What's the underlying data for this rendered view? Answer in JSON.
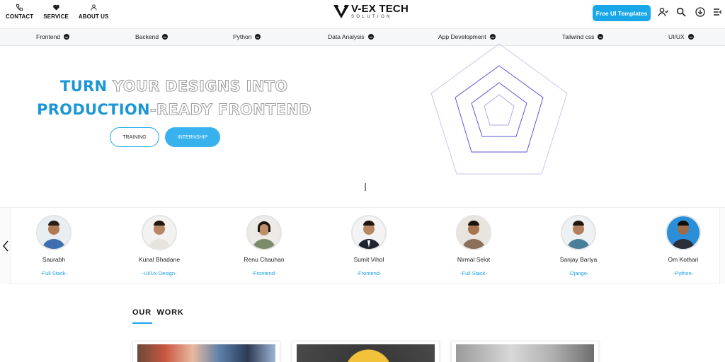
{
  "header": {
    "top_links": [
      {
        "label": "CONTACT",
        "icon": "phone-icon"
      },
      {
        "label": "SERVICE",
        "icon": "heart-handshake-icon"
      },
      {
        "label": "ABOUT US",
        "icon": "user-icon"
      }
    ],
    "logo": {
      "main": "V-EX TECH",
      "sub": "SOLUTION"
    },
    "cta_label": "Free UI Templates",
    "icons": [
      "user-check-icon",
      "search-icon",
      "download-icon",
      "menu-icon"
    ]
  },
  "categories": [
    "Frontend",
    "Backend",
    "Python",
    "Data Analysis",
    "App Development",
    "Tailwind css",
    "UI/UX"
  ],
  "hero": {
    "line1_a": "TURN",
    "line1_b": " YOUR DESIGNS INTO",
    "line2_a": "PRODUCTION",
    "line2_b": "-READY FRONTEND",
    "btn_training": "TRAINING",
    "btn_internship": "INTERNSHIP"
  },
  "team": [
    {
      "name": "Saurabh",
      "role": "-Full Stack-"
    },
    {
      "name": "Kunal Bhadane",
      "role": "-UI/Ux Design-"
    },
    {
      "name": "Renu Chauhan",
      "role": "-Frontend-"
    },
    {
      "name": "Sumit Vihol",
      "role": "-Frontend-"
    },
    {
      "name": "Nirmal Selot",
      "role": "-Full Stack-"
    },
    {
      "name": "Sanjay Bariya",
      "role": "-Django-"
    },
    {
      "name": "Om Kothari",
      "role": "-Python-"
    }
  ],
  "work": {
    "title": "OUR  WORK"
  },
  "colors": {
    "accent": "#1aa7ea",
    "heading_blue": "#1d96d6",
    "pentagon": "#5b55d6"
  }
}
